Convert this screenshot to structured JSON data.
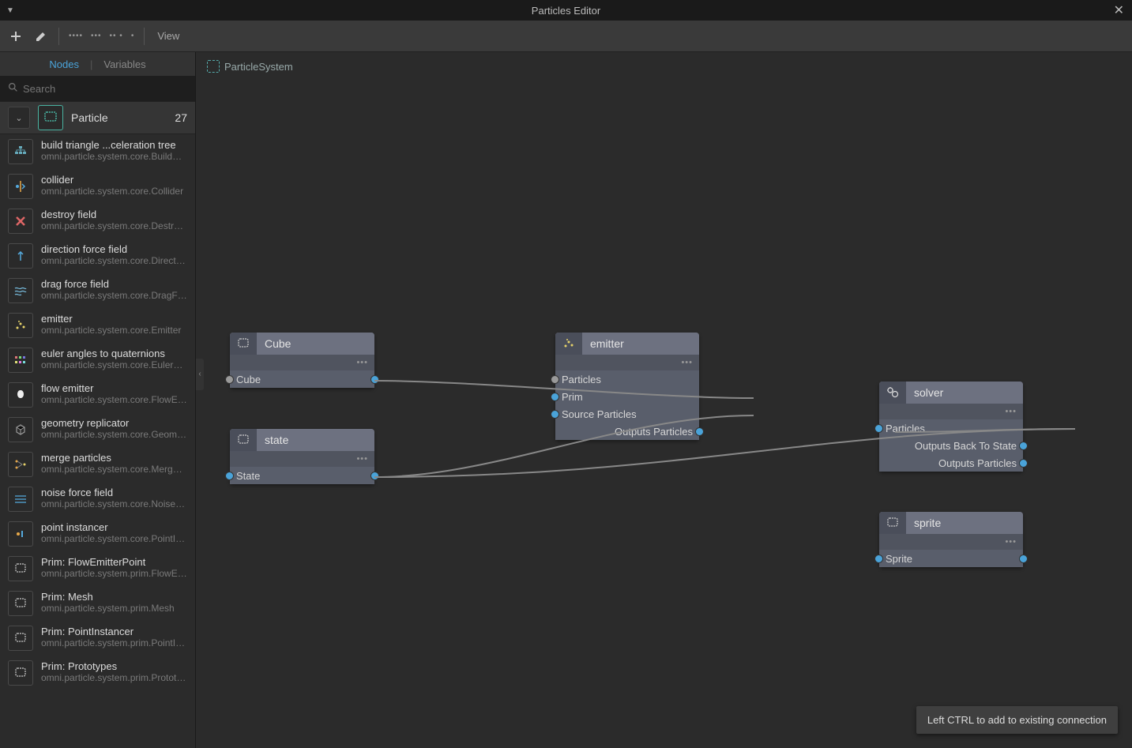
{
  "titlebar": {
    "title": "Particles Editor"
  },
  "toolbar": {
    "view": "View"
  },
  "sidebar": {
    "tabs": {
      "nodes": "Nodes",
      "variables": "Variables"
    },
    "search_placeholder": "Search",
    "category": {
      "name": "Particle",
      "count": "27"
    },
    "items": [
      {
        "name": "build triangle ...celeration tree",
        "path": "omni.particle.system.core.BuildAccelerationTree",
        "icon": "tree"
      },
      {
        "name": "collider",
        "path": "omni.particle.system.core.Collider",
        "icon": "collider"
      },
      {
        "name": "destroy field",
        "path": "omni.particle.system.core.DestroyField",
        "icon": "destroy"
      },
      {
        "name": "direction force field",
        "path": "omni.particle.system.core.DirectionForceField",
        "icon": "direction"
      },
      {
        "name": "drag force field",
        "path": "omni.particle.system.core.DragForceField",
        "icon": "drag"
      },
      {
        "name": "emitter",
        "path": "omni.particle.system.core.Emitter",
        "icon": "emitter"
      },
      {
        "name": "euler angles to quaternions",
        "path": "omni.particle.system.core.EulerAnglesToQuaternions",
        "icon": "euler"
      },
      {
        "name": "flow emitter",
        "path": "omni.particle.system.core.FlowEmitter",
        "icon": "flow"
      },
      {
        "name": "geometry replicator",
        "path": "omni.particle.system.core.GeometryReplicator",
        "icon": "geometry"
      },
      {
        "name": "merge particles",
        "path": "omni.particle.system.core.MergeParticles",
        "icon": "merge"
      },
      {
        "name": "noise force field",
        "path": "omni.particle.system.core.NoiseForceField",
        "icon": "noise"
      },
      {
        "name": "point instancer",
        "path": "omni.particle.system.core.PointInstancer",
        "icon": "point"
      },
      {
        "name": "Prim: FlowEmitterPoint",
        "path": "omni.particle.system.prim.FlowEmitterPoint",
        "icon": "prim"
      },
      {
        "name": "Prim: Mesh",
        "path": "omni.particle.system.prim.Mesh",
        "icon": "prim"
      },
      {
        "name": "Prim: PointInstancer",
        "path": "omni.particle.system.prim.PointInstancer",
        "icon": "prim"
      },
      {
        "name": "Prim: Prototypes",
        "path": "omni.particle.system.prim.Prototypes",
        "icon": "prim"
      }
    ]
  },
  "breadcrumb": {
    "label": "ParticleSystem"
  },
  "nodes": {
    "cube": {
      "title": "Cube",
      "port_in": "Cube"
    },
    "state": {
      "title": "state",
      "port_in": "State"
    },
    "emitter": {
      "title": "emitter",
      "inputs": [
        "Particles",
        "Prim",
        "Source Particles"
      ],
      "output": "Outputs Particles"
    },
    "solver": {
      "title": "solver",
      "inputs": [
        "Particles"
      ],
      "outputs": [
        "Outputs Back To State",
        "Outputs Particles"
      ]
    },
    "sprite": {
      "title": "sprite",
      "inputs": [
        "Sprite"
      ]
    }
  },
  "tooltip": "Left CTRL to add to existing connection"
}
